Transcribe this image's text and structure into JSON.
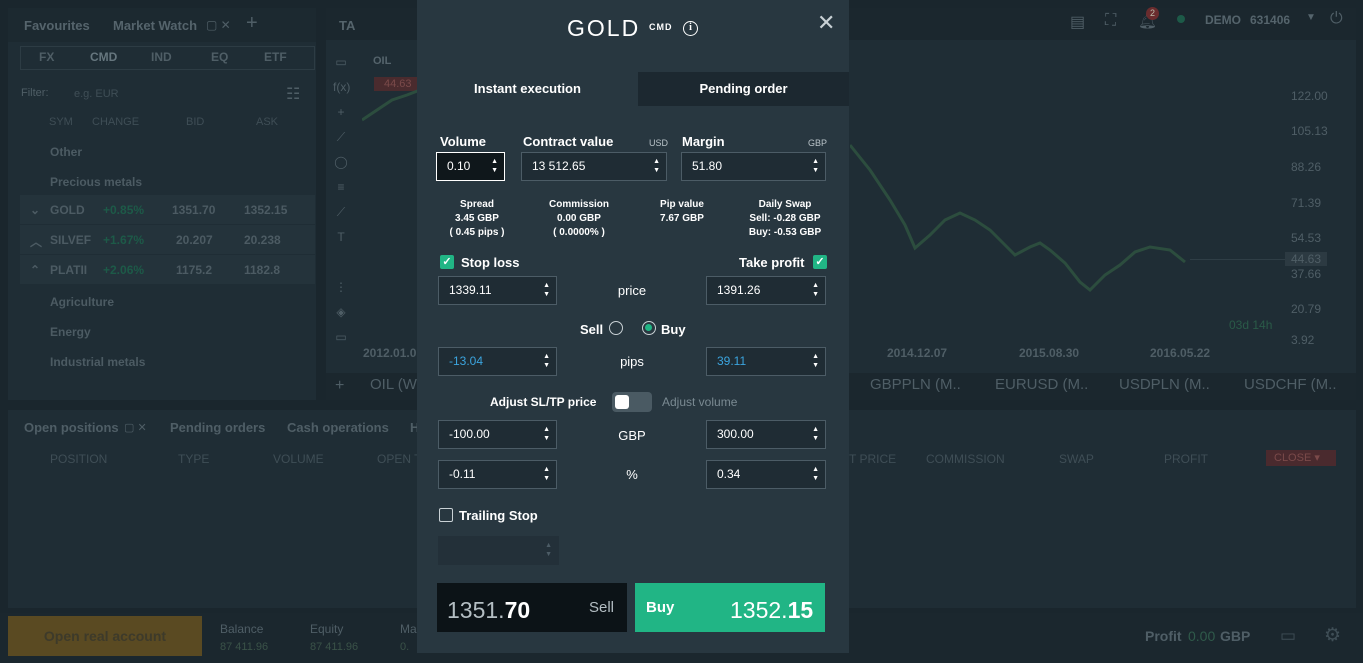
{
  "background": {
    "market_watch": {
      "tabs": [
        "Favourites",
        "Market Watch"
      ],
      "segments": [
        "FX",
        "CMD",
        "IND",
        "EQ",
        "ETF"
      ],
      "filter_label": "Filter:",
      "filter_placeholder": "e.g. EUR",
      "columns": [
        "SYM",
        "CHANGE",
        "BID",
        "ASK"
      ],
      "groups": [
        "Other",
        "Precious metals",
        "Agriculture",
        "Energy",
        "Industrial metals"
      ],
      "rows": [
        {
          "sym": "GOLD",
          "change": "+0.85%",
          "bid": "1351.70",
          "ask": "1352.15"
        },
        {
          "sym": "SILVEF",
          "change": "+1.67%",
          "bid": "20.207",
          "ask": "20.238"
        },
        {
          "sym": "PLATII",
          "change": "+2.06%",
          "bid": "1175.2",
          "ask": "1182.8"
        }
      ]
    },
    "chart": {
      "ta_label": "TA",
      "symbol": "OIL",
      "symbol_price": "44.63",
      "y_ticks": [
        "122.00",
        "105.13",
        "88.26",
        "71.39",
        "54.53",
        "37.66",
        "20.79",
        "3.92"
      ],
      "current_price": "44.63",
      "x_ticks": [
        "2012.01.0",
        "2014.12.07",
        "2015.08.30",
        "2016.05.22"
      ],
      "countdown": "03d 14h",
      "instrument_tabs": [
        "OIL (W",
        "GBPPLN (M..",
        "EURUSD (M..",
        "USDPLN (M..",
        "USDCHF (M.."
      ]
    },
    "header": {
      "notifications": "2",
      "account": "DEMO",
      "account_id": "631406"
    },
    "positions": {
      "tabs": [
        "Open positions",
        "Pending orders",
        "Cash operations",
        "H"
      ],
      "columns_left": [
        "POSITION",
        "TYPE",
        "VOLUME",
        "OPEN T"
      ],
      "columns_right": [
        "T PRICE",
        "COMMISSION",
        "SWAP",
        "PROFIT"
      ],
      "close_label": "CLOSE"
    },
    "footer": {
      "open_real": "Open real account",
      "balance_label": "Balance",
      "balance": "87 411.96",
      "equity_label": "Equity",
      "equity": "87 411.96",
      "margin_label": "Ma",
      "margin": "0.",
      "profit_label": "Profit",
      "profit_value": "0.00",
      "profit_ccy": "GBP"
    }
  },
  "modal": {
    "title": "GOLD",
    "category": "CMD",
    "info_icon": "i",
    "close_icon": "✕",
    "tabs": [
      "Instant execution",
      "Pending order"
    ],
    "volume": {
      "label": "Volume",
      "value": "0.10"
    },
    "contract_value": {
      "label": "Contract value",
      "unit": "USD",
      "value": "13 512.65"
    },
    "margin": {
      "label": "Margin",
      "unit": "GBP",
      "value": "51.80"
    },
    "stats": {
      "spread": {
        "label": "Spread",
        "line1": "3.45 GBP",
        "line2": "( 0.45 pips )"
      },
      "commission": {
        "label": "Commission",
        "line1": "0.00 GBP",
        "line2": "( 0.0000% )"
      },
      "pip_value": {
        "label": "Pip value",
        "line1": "7.67 GBP"
      },
      "daily_swap": {
        "label": "Daily Swap",
        "line1": "Sell: -0.28 GBP",
        "line2": "Buy: -0.53 GBP"
      }
    },
    "stop_loss": {
      "label": "Stop loss",
      "checked": true,
      "price": "1339.11",
      "pips": "-13.04",
      "gbp": "-100.00",
      "percent": "-0.11"
    },
    "take_profit": {
      "label": "Take profit",
      "checked": true,
      "price": "1391.26",
      "pips": "39.11",
      "gbp": "300.00",
      "percent": "0.34"
    },
    "price_label": "price",
    "pips_label": "pips",
    "gbp_label": "GBP",
    "percent_label": "%",
    "side": {
      "sell": "Sell",
      "buy": "Buy",
      "selected": "Buy"
    },
    "adjust": {
      "left": "Adjust SL/TP price",
      "right": "Adjust volume"
    },
    "trailing_stop": {
      "label": "Trailing Stop",
      "checked": false
    },
    "sell_button": {
      "label": "Sell",
      "price_main": "1351.",
      "price_big": "70"
    },
    "buy_button": {
      "label": "Buy",
      "price_main": "1352.",
      "price_big": "15"
    },
    "colors": {
      "accent": "#21b585",
      "negative_blue": "#3ba4de",
      "modal_bg": "#283740"
    }
  }
}
